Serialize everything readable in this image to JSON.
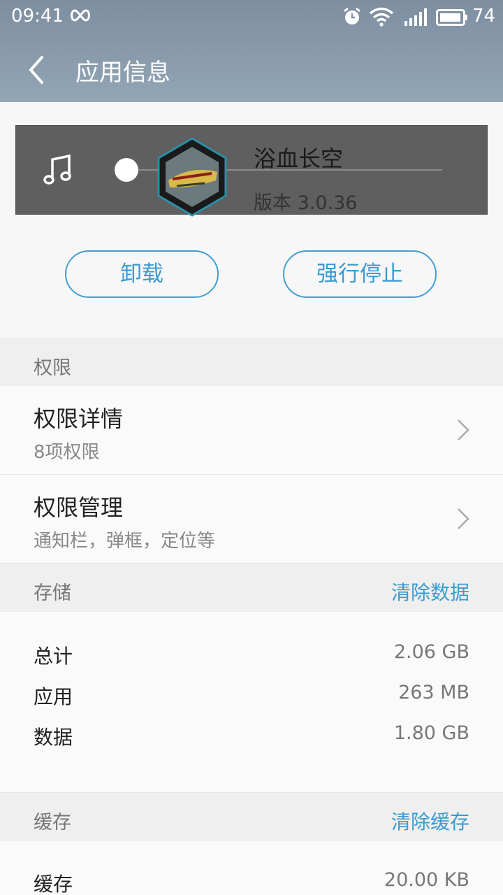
{
  "status_bar": {
    "time": "09:41",
    "battery": "74",
    "icons": [
      "infinity-icon",
      "alarm-icon",
      "wifi-icon",
      "signal-icon",
      "battery-icon"
    ]
  },
  "header": {
    "title": "应用信息"
  },
  "app": {
    "name": "浴血长空",
    "version": "版本 3.0.36"
  },
  "buttons": {
    "uninstall": "卸载",
    "force_stop": "强行停止"
  },
  "permissions": {
    "header": "权限",
    "items": [
      {
        "title": "权限详情",
        "subtitle": "8项权限"
      },
      {
        "title": "权限管理",
        "subtitle": "通知栏，弹框，定位等"
      }
    ]
  },
  "storage": {
    "header": "存储",
    "action": "清除数据",
    "rows": [
      {
        "label": "总计",
        "value": "2.06 GB"
      },
      {
        "label": "应用",
        "value": "263 MB"
      },
      {
        "label": "数据",
        "value": "1.80 GB"
      }
    ]
  },
  "cache": {
    "header": "缓存",
    "action": "清除缓存",
    "rows": [
      {
        "label": "缓存",
        "value": "20.00 KB"
      }
    ]
  },
  "colors": {
    "accent": "#3a9bd0",
    "titlebar": "#8a9cad",
    "card": "#5f5f5f"
  }
}
